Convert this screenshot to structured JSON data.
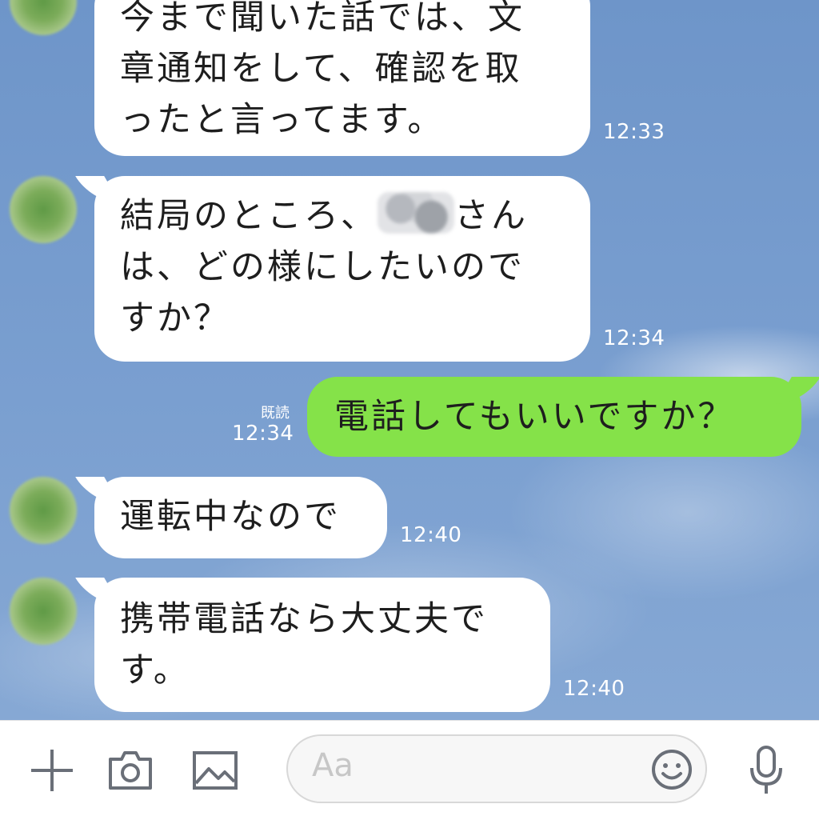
{
  "messages": [
    {
      "direction": "incoming",
      "lines": [
        "今まで聞いた話では、文",
        "章通知をして、確認を取",
        "ったと言ってます。"
      ],
      "time": "12:33"
    },
    {
      "direction": "incoming",
      "line1_before": "結局のところ、",
      "line1_after": "さん",
      "lines_rest": [
        "は、どの様にしたいので",
        "すか？"
      ],
      "time": "12:34"
    },
    {
      "direction": "outgoing",
      "text": "電話してもいいですか？",
      "read_label": "既読",
      "time": "12:34"
    },
    {
      "direction": "incoming",
      "text": "運転中なので",
      "time": "12:40"
    },
    {
      "direction": "incoming",
      "lines": [
        "携帯電話なら大丈夫で",
        "す。"
      ],
      "time": "12:40"
    }
  ],
  "input_bar": {
    "placeholder": "Aa",
    "icons": [
      "plus-icon",
      "camera-icon",
      "image-icon",
      "emoji-icon",
      "microphone-icon"
    ]
  },
  "colors": {
    "chat_background": "#7a9fd0",
    "incoming_bubble": "#ffffff",
    "outgoing_bubble": "#85e249",
    "timestamp": "#ffffff"
  }
}
